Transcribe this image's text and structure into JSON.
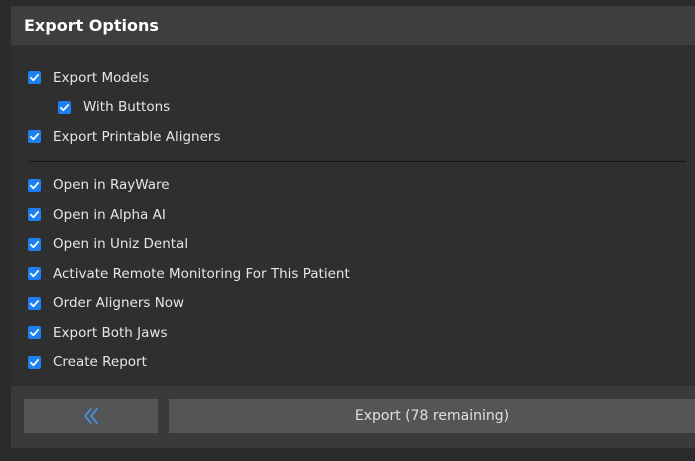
{
  "header": {
    "title": "Export Options"
  },
  "options_group1": [
    {
      "label": "Export Models",
      "checked": true,
      "indent": false
    },
    {
      "label": "With Buttons",
      "checked": true,
      "indent": true
    },
    {
      "label": "Export Printable Aligners",
      "checked": true,
      "indent": false
    }
  ],
  "options_group2": [
    {
      "label": "Open in RayWare",
      "checked": true
    },
    {
      "label": "Open in Alpha AI",
      "checked": true
    },
    {
      "label": "Open in Uniz Dental",
      "checked": true
    },
    {
      "label": "Activate Remote Monitoring For This Patient",
      "checked": true
    },
    {
      "label": "Order Aligners Now",
      "checked": true
    },
    {
      "label": "Export Both Jaws",
      "checked": true
    },
    {
      "label": "Create Report",
      "checked": true
    }
  ],
  "footer": {
    "back_icon": "double-chevron-left-icon",
    "export_label": "Export (78 remaining)"
  },
  "colors": {
    "checkbox": "#1e7ff0",
    "back_chevron": "#4a90d9"
  }
}
